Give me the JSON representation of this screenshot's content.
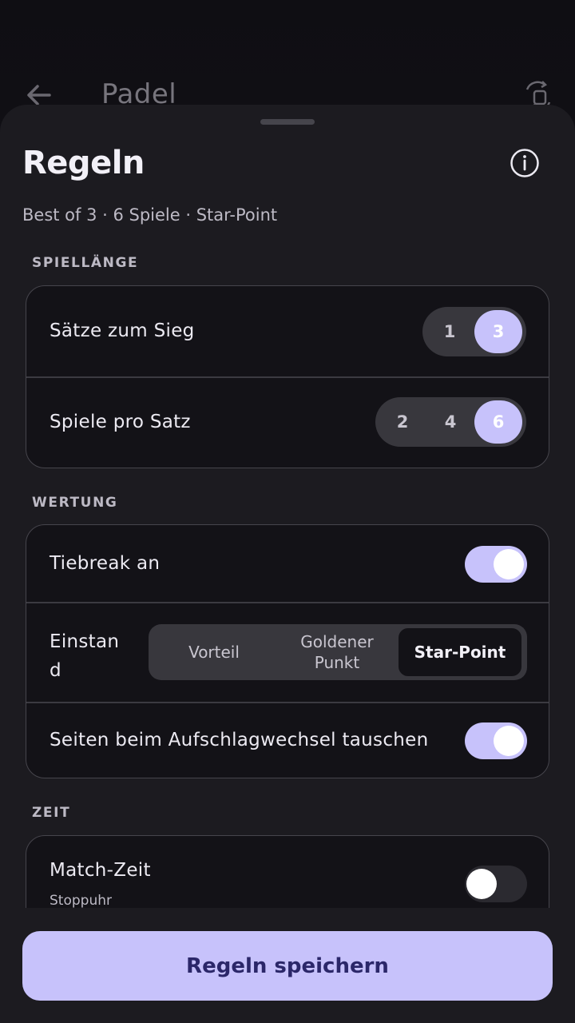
{
  "appbar": {
    "title": "Padel"
  },
  "sheet": {
    "title": "Regeln",
    "summary": "Best of 3 · 6 Spiele · Star-Point"
  },
  "sections": {
    "spiellaenge": "SPIELLÄNGE",
    "wertung": "WERTUNG",
    "zeit": "ZEIT"
  },
  "spiellaenge": {
    "saetze_label": "Sätze zum Sieg",
    "saetze_options": [
      "1",
      "3"
    ],
    "saetze_selected": "3",
    "spiele_label": "Spiele pro Satz",
    "spiele_options": [
      "2",
      "4",
      "6"
    ],
    "spiele_selected": "6"
  },
  "wertung": {
    "tiebreak_label": "Tiebreak an",
    "tiebreak_on": true,
    "einstand_label_line1": "Einstan",
    "einstand_label_line2": "d",
    "einstand_options": [
      "Vorteil",
      "Goldener Punkt",
      "Star-Point"
    ],
    "einstand_selected": "Star-Point",
    "seiten_label": "Seiten beim Aufschlagwechsel tauschen",
    "seiten_on": true
  },
  "zeit": {
    "match_zeit_label": "Match-Zeit",
    "match_zeit_sub": "Stoppuhr",
    "match_zeit_on": false
  },
  "footer": {
    "save_label": "Regeln speichern"
  },
  "colors": {
    "accent": "#C7C2FB",
    "sheet_bg": "#1c1b20",
    "card_bg": "#131217",
    "button_text": "#2b2769"
  }
}
